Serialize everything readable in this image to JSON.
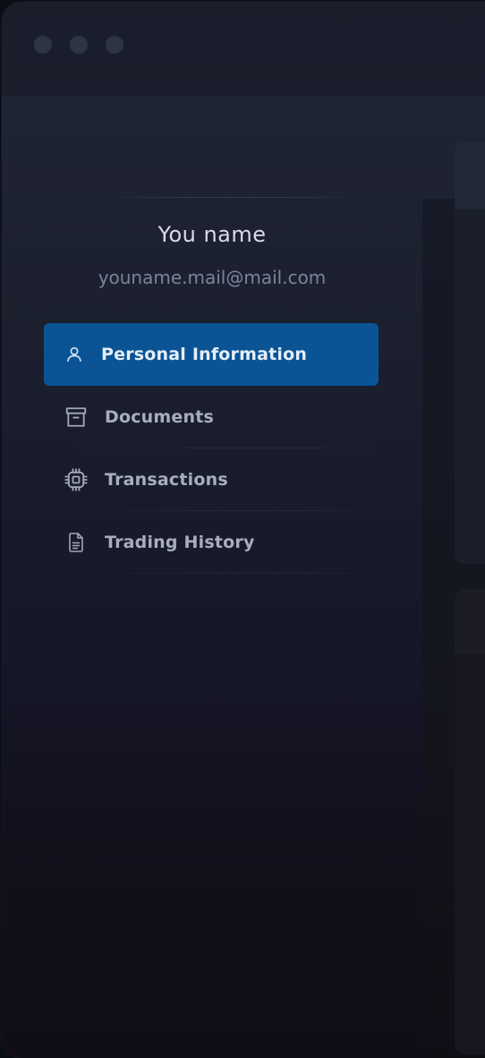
{
  "window": {
    "controls": [
      "close",
      "minimize",
      "maximize"
    ]
  },
  "profile": {
    "name": "You name",
    "email": "youname.mail@mail.com"
  },
  "nav": {
    "items": [
      {
        "label": "Personal Information",
        "icon": "user-icon",
        "active": true
      },
      {
        "label": "Documents",
        "icon": "archive-icon",
        "active": false
      },
      {
        "label": "Transactions",
        "icon": "chip-icon",
        "active": false
      },
      {
        "label": "Trading History",
        "icon": "file-text-icon",
        "active": false
      }
    ]
  },
  "colors": {
    "accent": "#0a5496",
    "background": "#1b1f2e",
    "text_primary": "#d9dce6",
    "text_muted": "#7d8499"
  }
}
